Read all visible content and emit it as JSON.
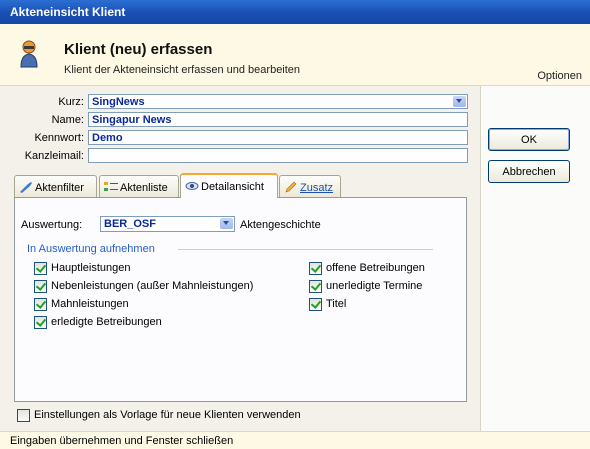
{
  "window": {
    "title": "Akteneinsicht Klient"
  },
  "header": {
    "title": "Klient (neu) erfassen",
    "subtitle": "Klient der Akteneinsicht erfassen und bearbeiten",
    "options": "Optionen"
  },
  "form": {
    "kurz_label": "Kurz:",
    "kurz_value": "SingNews",
    "name_label": "Name:",
    "name_value": "Singapur News",
    "kennwort_label": "Kennwort:",
    "kennwort_value": "Demo",
    "email_label": "Kanzleimail:",
    "email_value": ""
  },
  "tabs": [
    {
      "label": "Aktenfilter",
      "icon": "filter-icon"
    },
    {
      "label": "Aktenliste",
      "icon": "list-icon"
    },
    {
      "label": "Detailansicht",
      "icon": "eye-icon",
      "active": true
    },
    {
      "label": "Zusatz",
      "icon": "pencil-icon"
    }
  ],
  "detail": {
    "auswertung_label": "Auswertung:",
    "auswertung_value": "BER_OSF",
    "auswertung_desc": "Aktengeschichte",
    "group_label": "In Auswertung aufnehmen",
    "checks_left": [
      {
        "label": "Hauptleistungen",
        "checked": true
      },
      {
        "label": "Nebenleistungen (außer Mahnleistungen)",
        "checked": true
      },
      {
        "label": "Mahnleistungen",
        "checked": true
      },
      {
        "label": "erledigte Betreibungen",
        "checked": true
      }
    ],
    "checks_right": [
      {
        "label": "offene Betreibungen",
        "checked": true
      },
      {
        "label": "unerledigte Termine",
        "checked": true
      },
      {
        "label": "Titel",
        "checked": true
      }
    ]
  },
  "vorlage": {
    "label": "Einstellungen als Vorlage für neue Klienten verwenden",
    "checked": false
  },
  "buttons": {
    "ok": "OK",
    "cancel": "Abbrechen"
  },
  "status": "Eingaben übernehmen und Fenster schließen",
  "colors": {
    "titlebar": "#1a4fb3",
    "header_bg": "#fdf9e4",
    "field_text": "#0a2896",
    "group_label": "#2860c8",
    "check": "#21a121"
  }
}
